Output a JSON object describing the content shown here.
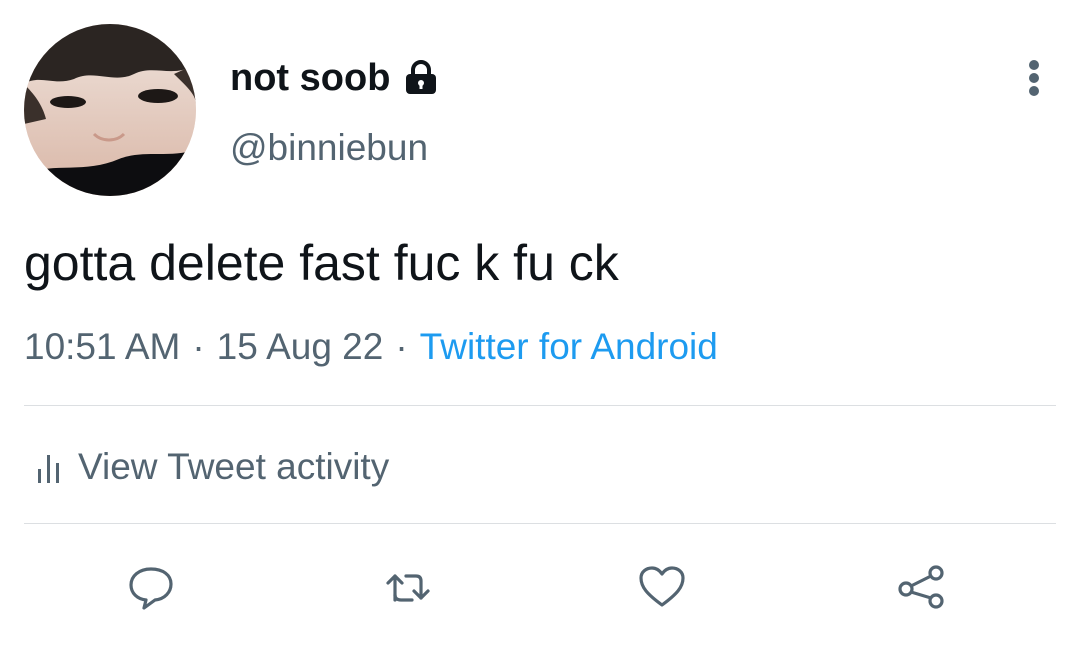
{
  "user": {
    "display_name": "not soob",
    "handle": "@binniebun",
    "protected_icon": "lock-icon"
  },
  "tweet": {
    "text": "gotta delete fast fuc k fu ck"
  },
  "meta": {
    "time": "10:51 AM",
    "separator": "·",
    "date": "15 Aug 22",
    "source": "Twitter for Android"
  },
  "activity": {
    "label": "View Tweet activity",
    "icon": "bar-chart-icon"
  },
  "actions": [
    {
      "name": "reply",
      "icon": "reply-icon"
    },
    {
      "name": "retweet",
      "icon": "retweet-icon"
    },
    {
      "name": "like",
      "icon": "heart-icon"
    },
    {
      "name": "share",
      "icon": "share-icon"
    }
  ],
  "colors": {
    "primary_text": "#0f1419",
    "secondary_text": "#536471",
    "link": "#1d9bf0",
    "divider": "#dcdfe2"
  }
}
